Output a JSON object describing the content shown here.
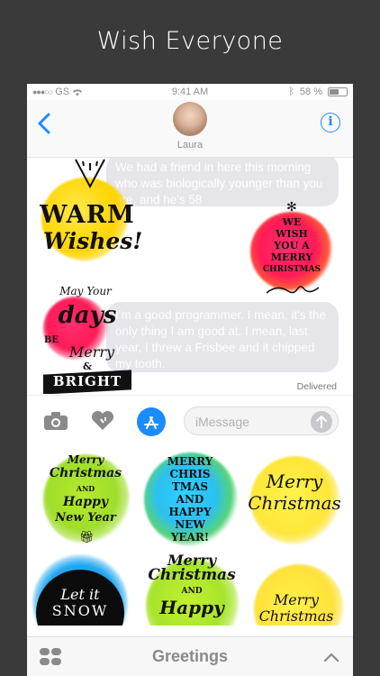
{
  "headline": "Wish Everyone",
  "status": {
    "carrier": "GS",
    "time": "9:41 AM",
    "battery": "58 %",
    "battery_level": 0.58
  },
  "nav": {
    "contact_name": "Laura",
    "info_glyph": "i"
  },
  "messages": [
    {
      "text": "We had a friend in here this morning who was biologically younger than you are, and he's 58"
    },
    {
      "text": "I'm a good programmer. I mean, it's the only thing I am good at. I mean, last year, I threw a Frisbee and it chipped my tooth."
    }
  ],
  "delivered_label": "Delivered",
  "transcript_stickers": {
    "warm_wishes": {
      "line1": "WARM",
      "line2": "Wishes!"
    },
    "we_wish": {
      "line1": "WE",
      "line2": "WISH",
      "line3": "YOU A",
      "line4": "MERRY",
      "line5": "CHRISTMAS"
    },
    "days_bright": {
      "line1": "May Your",
      "line2": "days",
      "line3": "BE",
      "line4": "Merry",
      "line5": "&",
      "line6": "BRIGHT"
    }
  },
  "input": {
    "placeholder": "iMessage"
  },
  "drawer_stickers": [
    {
      "lines": [
        "Merry",
        "Christmas",
        "AND",
        "Happy",
        "New Year"
      ]
    },
    {
      "lines": [
        "MERRY",
        "CHRIS",
        "TMAS",
        "AND",
        "HAPPY",
        "NEW",
        "YEAR!"
      ]
    },
    {
      "lines": [
        "Merry",
        "Christmas"
      ]
    },
    {
      "lines": [
        "Let it",
        "SNOW"
      ]
    },
    {
      "lines": [
        "Merry",
        "Christmas",
        "AND",
        "Happy"
      ]
    },
    {
      "lines": [
        "Merry",
        "Christmas"
      ]
    }
  ],
  "bottom_bar": {
    "title": "Greetings"
  },
  "colors": {
    "accent": "#1a8cff",
    "bubble": "#e5e5ea",
    "background": "#3a3a3a"
  },
  "icons": [
    "back-chevron-icon",
    "info-icon",
    "camera-icon",
    "digital-touch-heart-icon",
    "app-store-icon",
    "send-arrow-icon",
    "grid-icon",
    "chevron-up-icon",
    "wifi-icon",
    "bluetooth-icon",
    "battery-icon"
  ]
}
